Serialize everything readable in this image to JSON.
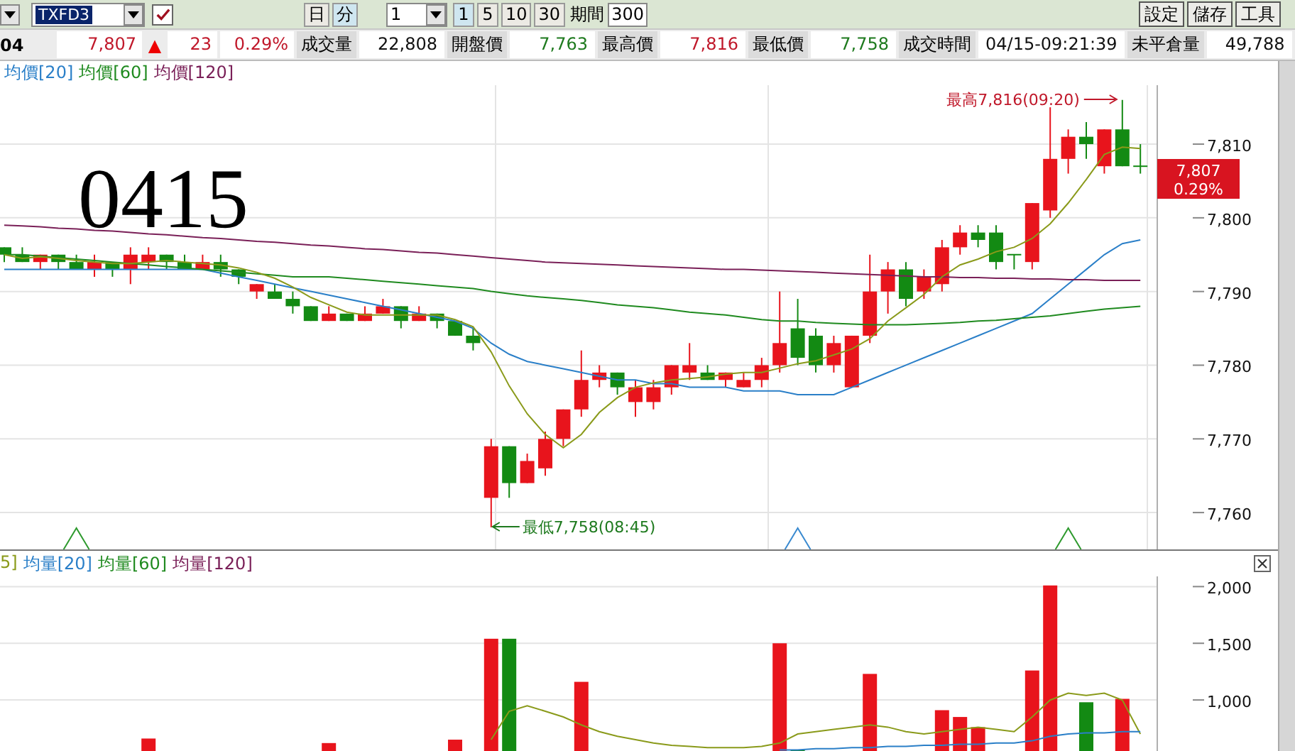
{
  "toolbar": {
    "symbol_select": {
      "value": "TXFD3"
    },
    "checkbox": {
      "checked": true
    },
    "unit_buttons": [
      {
        "label": "日",
        "selected": false
      },
      {
        "label": "分",
        "selected": true
      }
    ],
    "interval_select": {
      "value": "1"
    },
    "interval_buttons": [
      {
        "label": "1",
        "selected": true
      },
      {
        "label": "5",
        "selected": false
      },
      {
        "label": "10",
        "selected": false
      },
      {
        "label": "30",
        "selected": false
      }
    ],
    "period_label": "期間",
    "period_input": {
      "value": "300"
    },
    "action_buttons": [
      "設定",
      "儲存",
      "工具"
    ]
  },
  "quote_bar": {
    "code": "04",
    "last": "7,807",
    "direction_icon": "▲",
    "change": "23",
    "change_pct": "0.29%",
    "fields": [
      {
        "label": "成交量",
        "value": "22,808",
        "color": "#111111"
      },
      {
        "label": "開盤價",
        "value": "7,763",
        "color": "#1e7a1e"
      },
      {
        "label": "最高價",
        "value": "7,816",
        "color": "#c0182a"
      },
      {
        "label": "最低價",
        "value": "7,758",
        "color": "#1e7a1e"
      },
      {
        "label": "成交時間",
        "value": "04/15-09:21:39",
        "color": "#111111"
      },
      {
        "label": "未平倉量",
        "value": "49,788",
        "color": "#111111"
      }
    ]
  },
  "price_chart": {
    "note": "0415",
    "price_tag": {
      "price": "7,807",
      "change_pct": "0.29%"
    },
    "signals": [
      {
        "color": "#2e9a2e"
      },
      {
        "color": "#3a8ad0"
      },
      {
        "color": "#2e9a2e"
      }
    ],
    "chart_data": {
      "type": "candlestick",
      "grid": true,
      "ylim": [
        7755,
        7818
      ],
      "ohlc": [
        [
          7796,
          7796,
          7794,
          7795
        ],
        [
          7795,
          7796,
          7794,
          7794
        ],
        [
          7794,
          7795,
          7793,
          7795
        ],
        [
          7795,
          7795,
          7793,
          7794
        ],
        [
          7794,
          7795,
          7793,
          7793
        ],
        [
          7793,
          7795,
          7792,
          7794
        ],
        [
          7794,
          7794,
          7792,
          7793
        ],
        [
          7793,
          7796,
          7791,
          7795
        ],
        [
          7794,
          7796,
          7793,
          7795
        ],
        [
          7795,
          7795,
          7793,
          7794
        ],
        [
          7794,
          7795,
          7793,
          7793
        ],
        [
          7793,
          7795,
          7793,
          7794
        ],
        [
          7794,
          7795,
          7792,
          7793
        ],
        [
          7793,
          7793,
          7791,
          7792
        ],
        [
          7790,
          7791,
          7789,
          7791
        ],
        [
          7790,
          7791,
          7789,
          7789
        ],
        [
          7789,
          7790,
          7787,
          7788
        ],
        [
          7788,
          7788,
          7786,
          7786
        ],
        [
          7786,
          7788,
          7786,
          7787
        ],
        [
          7787,
          7787,
          7786,
          7786
        ],
        [
          7786,
          7788,
          7786,
          7787
        ],
        [
          7787,
          7789,
          7787,
          7788
        ],
        [
          7788,
          7788,
          7785,
          7786
        ],
        [
          7786,
          7788,
          7786,
          7787
        ],
        [
          7787,
          7787,
          7785,
          7786
        ],
        [
          7786,
          7786,
          7784,
          7784
        ],
        [
          7784,
          7785,
          7782,
          7783
        ],
        [
          7762,
          7770,
          7758,
          7769
        ],
        [
          7769,
          7769,
          7762,
          7764
        ],
        [
          7764,
          7768,
          7764,
          7767
        ],
        [
          7766,
          7771,
          7765,
          7770
        ],
        [
          7770,
          7774,
          7769,
          7774
        ],
        [
          7774,
          7782,
          7773,
          7778
        ],
        [
          7778,
          7780,
          7777,
          7779
        ],
        [
          7779,
          7779,
          7776,
          7777
        ],
        [
          7775,
          7778,
          7773,
          7777
        ],
        [
          7775,
          7778,
          7774,
          7777
        ],
        [
          7777,
          7780,
          7776,
          7780
        ],
        [
          7779,
          7783,
          7778,
          7780
        ],
        [
          7779,
          7780,
          7778,
          7778
        ],
        [
          7778,
          7779,
          7777,
          7779
        ],
        [
          7777,
          7779,
          7777,
          7778
        ],
        [
          7778,
          7781,
          7777,
          7780
        ],
        [
          7780,
          7790,
          7779,
          7783
        ],
        [
          7785,
          7789,
          7780,
          7781
        ],
        [
          7784,
          7785,
          7779,
          7780
        ],
        [
          7780,
          7784,
          7779,
          7783
        ],
        [
          7777,
          7784,
          7777,
          7784
        ],
        [
          7784,
          7795,
          7783,
          7790
        ],
        [
          7790,
          7794,
          7787,
          7793
        ],
        [
          7793,
          7794,
          7788,
          7789
        ],
        [
          7790,
          7793,
          7789,
          7792
        ],
        [
          7791,
          7797,
          7790,
          7796
        ],
        [
          7796,
          7799,
          7795,
          7798
        ],
        [
          7798,
          7799,
          7796,
          7797
        ],
        [
          7798,
          7799,
          7793,
          7794
        ],
        [
          7795,
          7795,
          7793,
          7795
        ],
        [
          7794,
          7802,
          7793,
          7802
        ],
        [
          7801,
          7815,
          7800,
          7808
        ],
        [
          7808,
          7812,
          7806,
          7811
        ],
        [
          7811,
          7813,
          7808,
          7810
        ],
        [
          7807,
          7812,
          7806,
          7812
        ],
        [
          7812,
          7816,
          7807,
          7807
        ],
        [
          7807,
          7810,
          7806,
          7807
        ]
      ],
      "yticks": [
        {
          "value": 7760,
          "label": "7,760"
        },
        {
          "value": 7770,
          "label": "7,770"
        },
        {
          "value": 7780,
          "label": "7,780"
        },
        {
          "value": 7790,
          "label": "7,790"
        },
        {
          "value": 7800,
          "label": "7,800"
        },
        {
          "value": 7810,
          "label": "7,810"
        }
      ],
      "series": [
        {
          "name": "均價[20]",
          "type": "line",
          "color": "#2a7fc8",
          "values": [
            7793,
            7793,
            7793,
            7793,
            7793,
            7793,
            7793,
            7793,
            7793,
            7793,
            7793,
            7793,
            7792.5,
            7792,
            7791.5,
            7791,
            7790.5,
            7790,
            7789.5,
            7789,
            7788.5,
            7788,
            7787.5,
            7787,
            7786.5,
            7786,
            7785,
            7783,
            7781.5,
            7780.5,
            7780,
            7779.5,
            7779,
            7778.5,
            7778,
            7778,
            7777.5,
            7777.5,
            7777,
            7777,
            7777,
            7776.5,
            7776.5,
            7776.5,
            7776,
            7776,
            7776,
            7777,
            7778,
            7779,
            7780,
            7781,
            7782,
            7783,
            7784,
            7785,
            7786,
            7787,
            7789,
            7791,
            7793,
            7795,
            7796.5,
            7797
          ]
        },
        {
          "name": "均價[60]",
          "type": "line",
          "color": "#1f8a1f",
          "values": [
            7795,
            7795,
            7794.8,
            7794.6,
            7794.4,
            7794.2,
            7794,
            7793.8,
            7793.6,
            7793.4,
            7793.2,
            7793,
            7792.8,
            7792.6,
            7792.4,
            7792.2,
            7792,
            7792,
            7792,
            7791.8,
            7791.6,
            7791.4,
            7791.2,
            7791,
            7790.8,
            7790.6,
            7790.4,
            7790,
            7789.7,
            7789.4,
            7789.2,
            7789,
            7788.8,
            7788.5,
            7788.2,
            7788,
            7787.8,
            7787.5,
            7787.2,
            7787,
            7786.8,
            7786.5,
            7786.2,
            7786,
            7786,
            7785.8,
            7785.7,
            7785.6,
            7785.5,
            7785.5,
            7785.5,
            7785.6,
            7785.7,
            7785.8,
            7786,
            7786.1,
            7786.3,
            7786.5,
            7786.7,
            7787,
            7787.3,
            7787.6,
            7787.8,
            7788
          ]
        },
        {
          "name": "均價[120]",
          "type": "line",
          "color": "#7a2058",
          "values": [
            7799,
            7798.9,
            7798.8,
            7798.6,
            7798.5,
            7798.3,
            7798.2,
            7798,
            7797.8,
            7797.7,
            7797.5,
            7797.3,
            7797.2,
            7797,
            7796.8,
            7796.7,
            7796.5,
            7796.3,
            7796.2,
            7796,
            7795.8,
            7795.7,
            7795.5,
            7795.3,
            7795.2,
            7795,
            7794.8,
            7794.6,
            7794.4,
            7794.2,
            7794,
            7793.9,
            7793.8,
            7793.7,
            7793.6,
            7793.5,
            7793.4,
            7793.3,
            7793.2,
            7793.1,
            7793,
            7793,
            7792.9,
            7792.8,
            7792.7,
            7792.6,
            7792.5,
            7792.4,
            7792.3,
            7792.2,
            7792.1,
            7792,
            7792,
            7791.9,
            7791.9,
            7791.8,
            7791.8,
            7791.7,
            7791.7,
            7791.6,
            7791.6,
            7791.5,
            7791.5,
            7791.5
          ]
        },
        {
          "type": "line",
          "color": "#8a9a1a",
          "values": [
            7795,
            7794.5,
            7794.7,
            7794.5,
            7794.2,
            7794,
            7793.8,
            7793.8,
            7794,
            7794.2,
            7794,
            7793.8,
            7793.6,
            7793.2,
            7792.6,
            7791.8,
            7790.6,
            7789.2,
            7788.2,
            7787.2,
            7786.8,
            7786.8,
            7786.8,
            7786.8,
            7786.8,
            7786.2,
            7785.2,
            7781.8,
            7777.2,
            7773.4,
            7770.6,
            7768.8,
            7770.6,
            7773.6,
            7775.6,
            7777,
            7777.6,
            7778,
            7778.2,
            7778.4,
            7778.8,
            7779,
            7779,
            7779.6,
            7780.2,
            7780.6,
            7781.4,
            7782.2,
            7783.6,
            7786,
            7787.8,
            7789.6,
            7792,
            7793.6,
            7794.4,
            7795.4,
            7796,
            7797.2,
            7799.2,
            7802,
            7805.2,
            7808.6,
            7809.6,
            7809.4
          ]
        }
      ],
      "annotations": [
        "最高7,816(09:20)",
        "最低7,758(08:45)"
      ]
    }
  },
  "volume_chart": {
    "chart_data": {
      "type": "bar",
      "grid": true,
      "stacked": false,
      "ylim": [
        550,
        2090
      ],
      "yticks": [
        {
          "value": 1000,
          "label": "1,000"
        },
        {
          "value": 1500,
          "label": "1,500"
        },
        {
          "value": 2000,
          "label": "2,000"
        }
      ],
      "colors": [
        null,
        null,
        null,
        null,
        null,
        null,
        null,
        null,
        "#e8141c",
        null,
        null,
        null,
        null,
        null,
        null,
        null,
        null,
        null,
        "#e8141c",
        null,
        null,
        null,
        null,
        null,
        null,
        "#e8141c",
        null,
        "#e8141c",
        "#138a13",
        null,
        null,
        null,
        "#e8141c",
        null,
        null,
        null,
        null,
        null,
        null,
        null,
        null,
        null,
        null,
        "#e8141c",
        "#138a13",
        null,
        null,
        null,
        "#e8141c",
        null,
        null,
        null,
        "#e8141c",
        "#e8141c",
        "#e8141c",
        null,
        null,
        "#e8141c",
        "#e8141c",
        null,
        "#138a13",
        null,
        "#e8141c",
        null
      ],
      "values": [
        null,
        null,
        null,
        null,
        null,
        null,
        null,
        null,
        660,
        null,
        null,
        null,
        null,
        null,
        null,
        null,
        null,
        null,
        620,
        null,
        null,
        null,
        null,
        null,
        null,
        650,
        null,
        1540,
        1540,
        null,
        null,
        null,
        1160,
        null,
        null,
        null,
        null,
        null,
        null,
        null,
        null,
        null,
        null,
        1500,
        560,
        null,
        null,
        null,
        1230,
        null,
        null,
        null,
        910,
        850,
        760,
        null,
        null,
        1260,
        2010,
        null,
        980,
        null,
        1010,
        null
      ],
      "series": [
        {
          "name": "5]",
          "type": "line",
          "color": "#8a9a1a",
          "values": [
            null,
            null,
            null,
            null,
            null,
            null,
            null,
            null,
            null,
            null,
            null,
            null,
            null,
            null,
            null,
            null,
            null,
            null,
            null,
            null,
            null,
            null,
            null,
            null,
            null,
            null,
            null,
            650,
            900,
            950,
            900,
            850,
            780,
            720,
            680,
            650,
            620,
            600,
            590,
            580,
            580,
            580,
            590,
            620,
            700,
            720,
            740,
            760,
            780,
            760,
            720,
            700,
            720,
            740,
            760,
            740,
            720,
            850,
            1000,
            1060,
            1040,
            1060,
            1000,
            700
          ]
        },
        {
          "name": "均量[20]",
          "type": "line",
          "color": "#2a7fc8",
          "values": [
            null,
            null,
            null,
            null,
            null,
            null,
            null,
            null,
            null,
            null,
            null,
            null,
            null,
            null,
            null,
            null,
            null,
            null,
            null,
            null,
            null,
            null,
            null,
            null,
            null,
            null,
            null,
            null,
            null,
            null,
            null,
            null,
            null,
            null,
            null,
            null,
            null,
            null,
            null,
            null,
            null,
            null,
            null,
            560,
            560,
            570,
            570,
            580,
            580,
            590,
            590,
            600,
            600,
            610,
            610,
            620,
            620,
            640,
            680,
            700,
            710,
            710,
            720,
            720
          ]
        },
        {
          "name": "均量[60]",
          "type": "line",
          "color": "#1f8a1f"
        },
        {
          "name": "均量[120]",
          "type": "line",
          "color": "#7a2058"
        }
      ]
    }
  }
}
